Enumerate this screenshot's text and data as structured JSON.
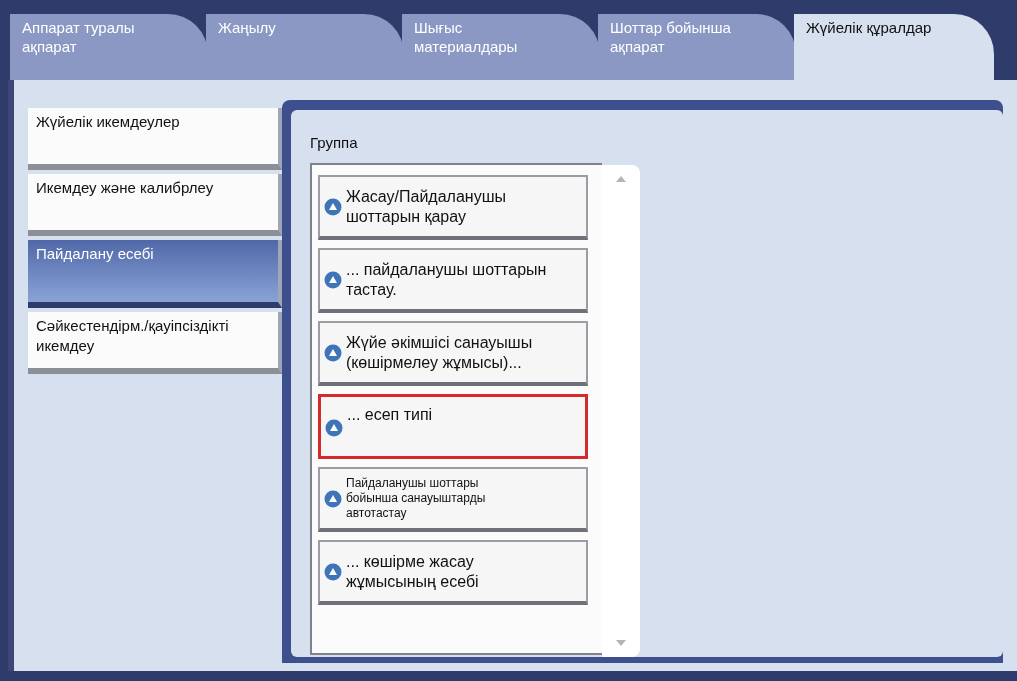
{
  "tabs": [
    {
      "label": "Аппарат туралы\nақпарат",
      "selected": false
    },
    {
      "label": "Жаңылу",
      "selected": false
    },
    {
      "label": "Шығыс\nматериалдары",
      "selected": false
    },
    {
      "label": "Шоттар бойынша\nақпарат",
      "selected": false
    },
    {
      "label": "Жүйелік құралдар",
      "selected": true
    }
  ],
  "sidebar": {
    "items": [
      {
        "label": "Жүйелік икемдеулер",
        "selected": false
      },
      {
        "label": "Икемдеу және калибрлеу",
        "selected": false
      },
      {
        "label": "Пайдалану есебі",
        "selected": true
      },
      {
        "label": "Сәйкестендірм./қауіпсіздікті\nикемдеу",
        "selected": false
      }
    ]
  },
  "group": {
    "title": "Группа",
    "items": [
      {
        "label": "Жасау/Пайдаланушы\nшоттарын қарау",
        "selected": false,
        "kind": "normal"
      },
      {
        "label": "... пайдаланушы шоттарын\n тастау.",
        "selected": false,
        "kind": "normal"
      },
      {
        "label": "Жүйе әкімшісі санауышы\n(көшірмелеу жұмысы)...",
        "selected": false,
        "kind": "normal"
      },
      {
        "label": "... есеп типі",
        "selected": true,
        "kind": "normal"
      },
      {
        "label": "Пайдаланушы  шоттары\nбойынша  санауыштарды\nавтотастау",
        "selected": false,
        "kind": "small"
      },
      {
        "label": "... көшірме жасау\nжұмысының есебі",
        "selected": false,
        "kind": "normal"
      }
    ]
  }
}
